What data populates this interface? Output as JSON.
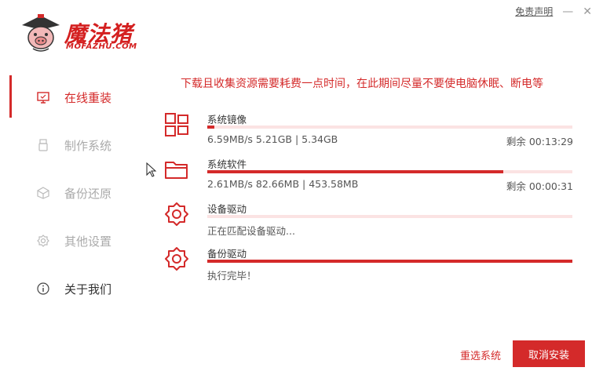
{
  "titlebar": {
    "disclaimer": "免责声明",
    "minimize": "—",
    "close": "✕"
  },
  "logo": {
    "name": "魔法猪",
    "domain": "MOFAZHU.COM"
  },
  "sidebar": {
    "items": [
      {
        "label": "在线重装",
        "icon": "monitor-icon"
      },
      {
        "label": "制作系统",
        "icon": "usb-icon"
      },
      {
        "label": "备份还原",
        "icon": "cube-icon"
      },
      {
        "label": "其他设置",
        "icon": "gear-icon"
      },
      {
        "label": "关于我们",
        "icon": "info-icon"
      }
    ]
  },
  "notice": "下载且收集资源需要耗费一点时间，在此期间尽量不要使电脑休眠、断电等",
  "tasks": [
    {
      "name": "系统镜像",
      "icon": "windows-icon",
      "info": "6.59MB/s 5.21GB | 5.34GB",
      "remaining": "剩余 00:13:29",
      "progress": 0.02
    },
    {
      "name": "系统软件",
      "icon": "folder-icon",
      "info": "2.61MB/s 82.66MB | 453.58MB",
      "remaining": "剩余 00:00:31",
      "progress": 0.81
    },
    {
      "name": "设备驱动",
      "icon": "gear-icon",
      "info": "正在匹配设备驱动...",
      "remaining": "",
      "progress": 0.0
    },
    {
      "name": "备份驱动",
      "icon": "gear-icon",
      "info": "执行完毕！",
      "remaining": "",
      "progress": 1.0
    }
  ],
  "buttons": {
    "reselect": "重选系统",
    "cancel": "取消安装"
  },
  "colors": {
    "accent": "#d42a2a",
    "track": "#fbe3e3"
  }
}
